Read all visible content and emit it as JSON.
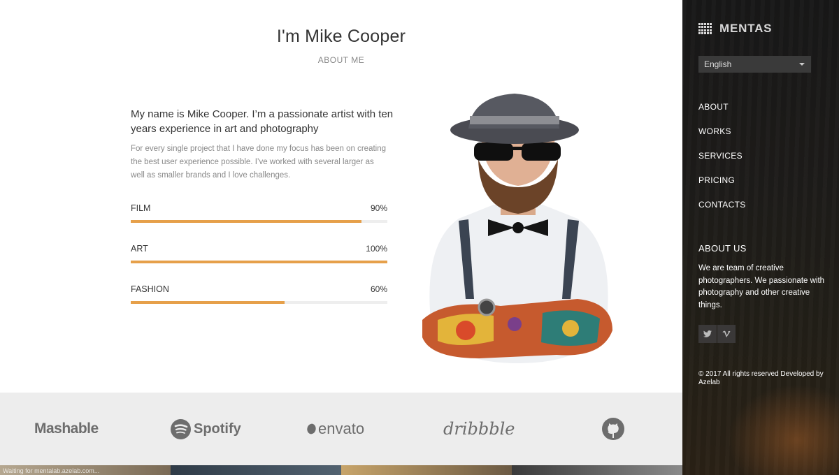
{
  "header": {
    "title": "I'm Mike Cooper",
    "subtitle": "ABOUT ME"
  },
  "intro": {
    "lead": "My name is Mike Cooper. I’m a passionate artist with ten years experience in art and photography",
    "body": "For every single project that I have done my focus has been on creating the best user experience possible. I’ve worked with several larger as well as smaller brands and I love challenges."
  },
  "skills": [
    {
      "label": "FILM",
      "percent_text": "90%",
      "value": 0.9
    },
    {
      "label": "ART",
      "percent_text": "100%",
      "value": 1.0
    },
    {
      "label": "FASHION",
      "percent_text": "60%",
      "value": 0.6
    }
  ],
  "brands": {
    "mashable": "Mashable",
    "spotify": "Spotify",
    "envato": "envato",
    "dribbble": "dribbble",
    "github_icon": "github-icon"
  },
  "status_bar": "Waiting for mentalab.azelab.com...",
  "sidebar": {
    "logo_text": "MENTAS",
    "language": "English",
    "nav": [
      "ABOUT",
      "WORKS",
      "SERVICES",
      "PRICING",
      "CONTACTS"
    ],
    "about_title": "ABOUT US",
    "about_text": "We are team of creative photographers. We passionate with photography and other creative things.",
    "social_icons": [
      "twitter-icon",
      "vimeo-icon"
    ],
    "copyright": "© 2017 All rights reserved Developed by Azelab"
  },
  "colors": {
    "accent": "#e6a04a",
    "track": "#eeeeee",
    "sidebar_bg": "#1b1a19"
  }
}
